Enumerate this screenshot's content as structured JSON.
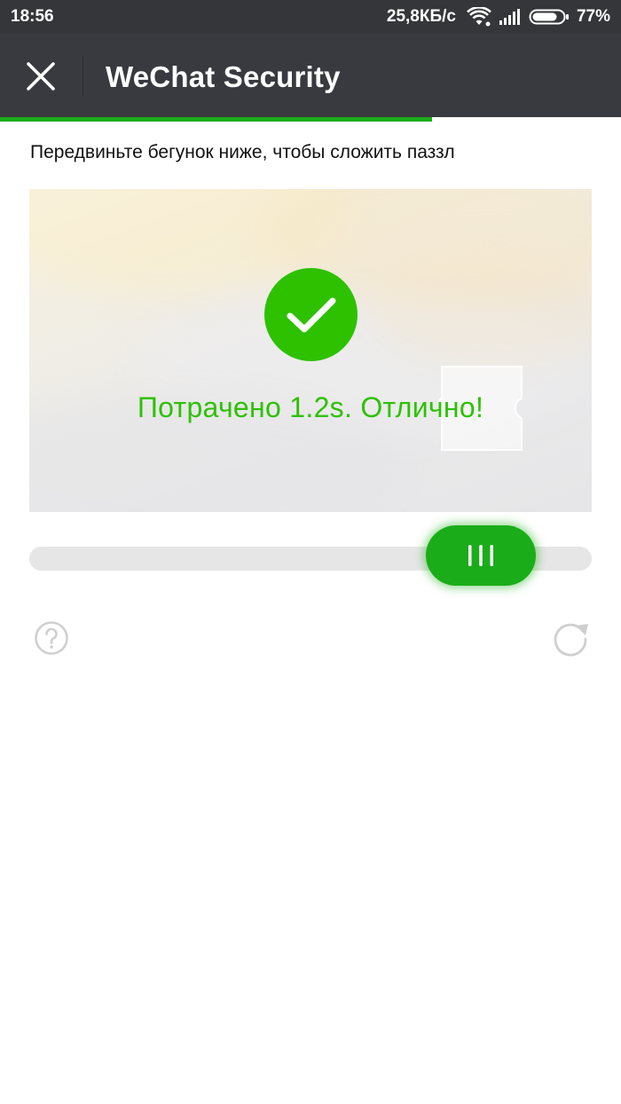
{
  "status_bar": {
    "time": "18:56",
    "network_speed": "25,8КБ/с",
    "battery": "77%",
    "icons": [
      "wifi-icon",
      "cellular-signal-icon",
      "battery-icon"
    ]
  },
  "header": {
    "title": "WeChat Security",
    "close_icon": "close-icon",
    "load_progress": 0.695
  },
  "instruction": "Передвиньте бегунок ниже, чтобы сложить паззл",
  "puzzle": {
    "success_icon": "checkmark-icon",
    "success_message": "Потрачено 1.2s. Отлично!"
  },
  "slider": {
    "handle_icon": "grip-lines-icon",
    "position": 0.82
  },
  "footer": {
    "help_icon": "help-icon",
    "refresh_icon": "refresh-icon"
  },
  "colors": {
    "accent": "#1aad19",
    "success": "#2dc100",
    "header_bg": "#393a3f",
    "status_bg": "#35363a",
    "track": "#e6e6e6"
  }
}
